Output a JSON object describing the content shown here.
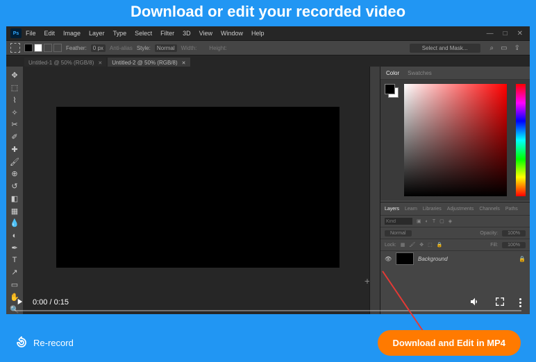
{
  "header": {
    "title": "Download or edit your recorded video"
  },
  "app": {
    "logo": "Ps",
    "menu": [
      "File",
      "Edit",
      "Image",
      "Layer",
      "Type",
      "Select",
      "Filter",
      "3D",
      "View",
      "Window",
      "Help"
    ],
    "window_controls": [
      "—",
      "□",
      "✕"
    ]
  },
  "options_bar": {
    "feather_label": "Feather:",
    "feather_value": "0 px",
    "antialias": "Anti-alias",
    "style_label": "Style:",
    "style_value": "Normal",
    "width_label": "Width:",
    "height_label": "Height:",
    "mask_button": "Select and Mask..."
  },
  "tabs": [
    {
      "label": "Untitled-1 @ 50% (RGB/8)",
      "active": false
    },
    {
      "label": "Untitled-2 @ 50% (RGB/8)",
      "active": true
    }
  ],
  "panels": {
    "color_tabs": [
      "Color",
      "Swatches"
    ],
    "layer_tabs": [
      "Layers",
      "Learn",
      "Libraries",
      "Adjustments",
      "Channels",
      "Paths"
    ],
    "filter_placeholder": "Kind",
    "blend_mode": "Normal",
    "opacity_label": "Opacity:",
    "opacity_value": "100%",
    "lock_label": "Lock:",
    "fill_label": "Fill:",
    "fill_value": "100%",
    "layer_name": "Background"
  },
  "video": {
    "current": "0:00",
    "separator": " / ",
    "duration": "0:15"
  },
  "footer": {
    "rerecord": "Re-record",
    "download": "Download and Edit in MP4"
  }
}
